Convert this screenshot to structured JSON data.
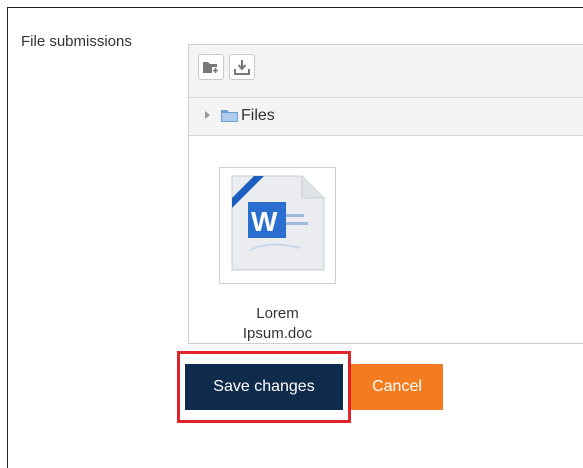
{
  "field": {
    "label": "File submissions"
  },
  "toolbar": {
    "add_icon": "folder-add-icon",
    "download_icon": "download-icon"
  },
  "path": {
    "expand_icon": "triangle-right-icon",
    "folder_icon": "folder-icon",
    "label": "Files"
  },
  "files": [
    {
      "name": "Lorem",
      "name_cont": "Ipsum.doc",
      "icon": "word-document-icon"
    }
  ],
  "actions": {
    "save_label": "Save changes",
    "cancel_label": "Cancel"
  },
  "colors": {
    "save_bg": "#0f2b4c",
    "cancel_bg": "#f47c20",
    "highlight": "#e0222a"
  }
}
